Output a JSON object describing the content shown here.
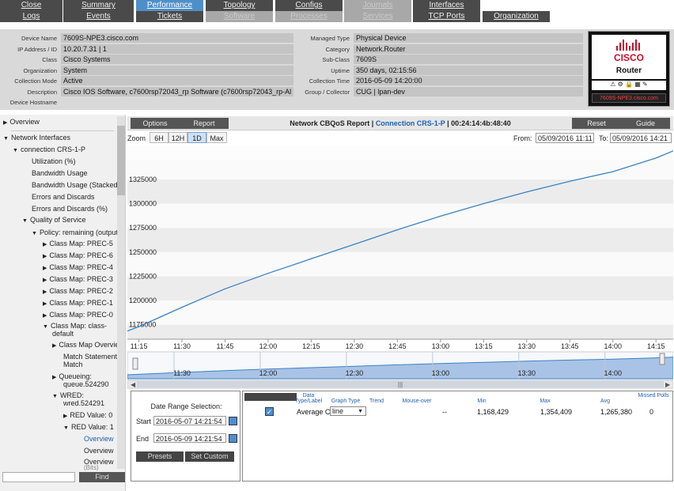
{
  "tabs_row1": [
    {
      "label": "Close",
      "state": "normal"
    },
    {
      "label": "Summary",
      "state": "normal"
    },
    {
      "label": "Performance",
      "state": "active"
    },
    {
      "label": "Topology",
      "state": "normal"
    },
    {
      "label": "Configs",
      "state": "normal"
    },
    {
      "label": "Journals",
      "state": "disabled"
    },
    {
      "label": "Interfaces",
      "state": "normal"
    }
  ],
  "tabs_row2": [
    {
      "label": "Logs",
      "state": "normal"
    },
    {
      "label": "Events",
      "state": "normal"
    },
    {
      "label": "Tickets",
      "state": "normal"
    },
    {
      "label": "Software",
      "state": "disabled"
    },
    {
      "label": "Processes",
      "state": "disabled"
    },
    {
      "label": "Services",
      "state": "disabled"
    },
    {
      "label": "TCP Ports",
      "state": "normal"
    },
    {
      "label": "Organization",
      "state": "normal"
    }
  ],
  "device_info": {
    "left": [
      {
        "label": "Device Name",
        "value": "7609S-NPE3.cisco.com"
      },
      {
        "label": "IP Address / ID",
        "value": "10.20.7.31 | 1"
      },
      {
        "label": "Class",
        "value": "Cisco Systems"
      },
      {
        "label": "Organization",
        "value": "System"
      },
      {
        "label": "Collection Mode",
        "value": "Active"
      },
      {
        "label": "Description",
        "value": "Cisco IOS Software, c7600rsp72043_rp Software (c7600rsp72043_rp-Al"
      },
      {
        "label": "Device Hostname",
        "value": ""
      }
    ],
    "right": [
      {
        "label": "Managed Type",
        "value": "Physical Device"
      },
      {
        "label": "Category",
        "value": "Network.Router"
      },
      {
        "label": "Sub-Class",
        "value": "7609S"
      },
      {
        "label": "Uptime",
        "value": "350 days, 02:15:56"
      },
      {
        "label": "Collection Time",
        "value": "2016-05-09 14:20:00"
      },
      {
        "label": "Group / Collector",
        "value": "CUG | lpan-dev"
      }
    ],
    "logo": {
      "brand": "CISCO",
      "type": "Router",
      "name": "7609S-NPE3.cisco.com",
      "icons": "⚠ ⚙ 🔒 ▦ ✎"
    }
  },
  "tree": {
    "items": [
      {
        "label": "Overview",
        "tri": "▶"
      },
      {
        "label": "Network Interfaces",
        "tri": "▼"
      },
      {
        "label": "connection CRS-1-P",
        "tri": "▼"
      },
      {
        "label": "Utilization (%)",
        "tri": ""
      },
      {
        "label": "Bandwidth Usage",
        "tri": ""
      },
      {
        "label": "Bandwidth Usage (Stacked)",
        "tri": ""
      },
      {
        "label": "Errors and Discards",
        "tri": ""
      },
      {
        "label": "Errors and Discards (%)",
        "tri": ""
      },
      {
        "label": "Quality of Service",
        "tri": "▼"
      },
      {
        "label": "Policy: remaining (output)",
        "tri": "▼"
      },
      {
        "label": "Class Map: PREC-5",
        "tri": "▶"
      },
      {
        "label": "Class Map: PREC-6",
        "tri": "▶"
      },
      {
        "label": "Class Map: PREC-4",
        "tri": "▶"
      },
      {
        "label": "Class Map: PREC-3",
        "tri": "▶"
      },
      {
        "label": "Class Map: PREC-2",
        "tri": "▶"
      },
      {
        "label": "Class Map: PREC-1",
        "tri": "▶"
      },
      {
        "label": "Class Map: PREC-0",
        "tri": "▶"
      },
      {
        "label": "Class Map: class-",
        "tri": "▼"
      },
      {
        "label": "default",
        "tri": ""
      },
      {
        "label": "Class Map Overview",
        "tri": "▶"
      },
      {
        "label": "Match Statement",
        "tri": ""
      },
      {
        "label": "Match",
        "tri": ""
      },
      {
        "label": "Queueing:",
        "tri": "▶"
      },
      {
        "label": "queue.524290",
        "tri": ""
      },
      {
        "label": "WRED:",
        "tri": "▼"
      },
      {
        "label": "wred.524291",
        "tri": ""
      },
      {
        "label": "RED Value: 0",
        "tri": "▶"
      },
      {
        "label": "RED Value: 1",
        "tri": "▼"
      },
      {
        "label": "Overview",
        "tri": ""
      },
      {
        "label": "Overview",
        "tri": ""
      },
      {
        "label": "Overview",
        "tri": ""
      },
      {
        "label": "(Bits)",
        "tri": ""
      }
    ],
    "find_label": "Find"
  },
  "report": {
    "options_label": "Options",
    "report_label": "Report",
    "reset_label": "Reset",
    "guide_label": "Guide",
    "title_prefix": "Network CBQoS Report | ",
    "title_connection": "Connection CRS-1-P",
    "title_suffix": " | 00:24:14:4b:48:40",
    "zoom_label": "Zoom",
    "zoom_options": [
      "6H",
      "12H",
      "1D",
      "Max"
    ],
    "zoom_active": "1D",
    "from_label": "From:",
    "from_value": "05/09/2016 11:11",
    "to_label": "To:",
    "to_value": "05/09/2016 14:21"
  },
  "chart_data": {
    "type": "line",
    "x_ticks": [
      "11:15",
      "11:30",
      "11:45",
      "12:00",
      "12:15",
      "12:30",
      "12:45",
      "13:00",
      "13:15",
      "13:30",
      "13:45",
      "14:00",
      "14:15"
    ],
    "y_ticks": [
      1175000,
      1200000,
      1225000,
      1250000,
      1275000,
      1300000,
      1325000
    ],
    "ylim": [
      1160000,
      1360000
    ],
    "series": [
      {
        "name": "Average C",
        "color": "#3a82c4",
        "x": [
          "11:11",
          "11:15",
          "11:30",
          "11:45",
          "12:00",
          "12:15",
          "12:30",
          "12:45",
          "13:00",
          "13:15",
          "13:30",
          "13:45",
          "14:00",
          "14:15",
          "14:21"
        ],
        "y": [
          1168429,
          1173000,
          1193000,
          1212000,
          1228000,
          1243000,
          1258000,
          1273000,
          1287000,
          1300000,
          1312000,
          1323000,
          1333000,
          1347000,
          1354409
        ]
      }
    ],
    "navigator_ticks": [
      "11:30",
      "12:00",
      "12:30",
      "13:00",
      "13:30",
      "14:00"
    ]
  },
  "date_range": {
    "title": "Date Range Selection:",
    "start_label": "Start",
    "start_value": "2016-05-07 14:21:54",
    "end_label": "End",
    "end_value": "2016-05-09 14:21:54",
    "presets_label": "Presets",
    "set_custom_label": "Set Custom"
  },
  "legend_table": {
    "headers": [
      "Data Type/Label",
      "Graph Type",
      "Trend",
      "Mouse-over",
      "Min",
      "Max",
      "Avg",
      "Missed Polls"
    ],
    "row": {
      "label": "Average C",
      "graph_type": "line",
      "mouse_over": "--",
      "min": "1,168,429",
      "max": "1,354,409",
      "avg": "1,265,380",
      "missed": "0"
    }
  }
}
